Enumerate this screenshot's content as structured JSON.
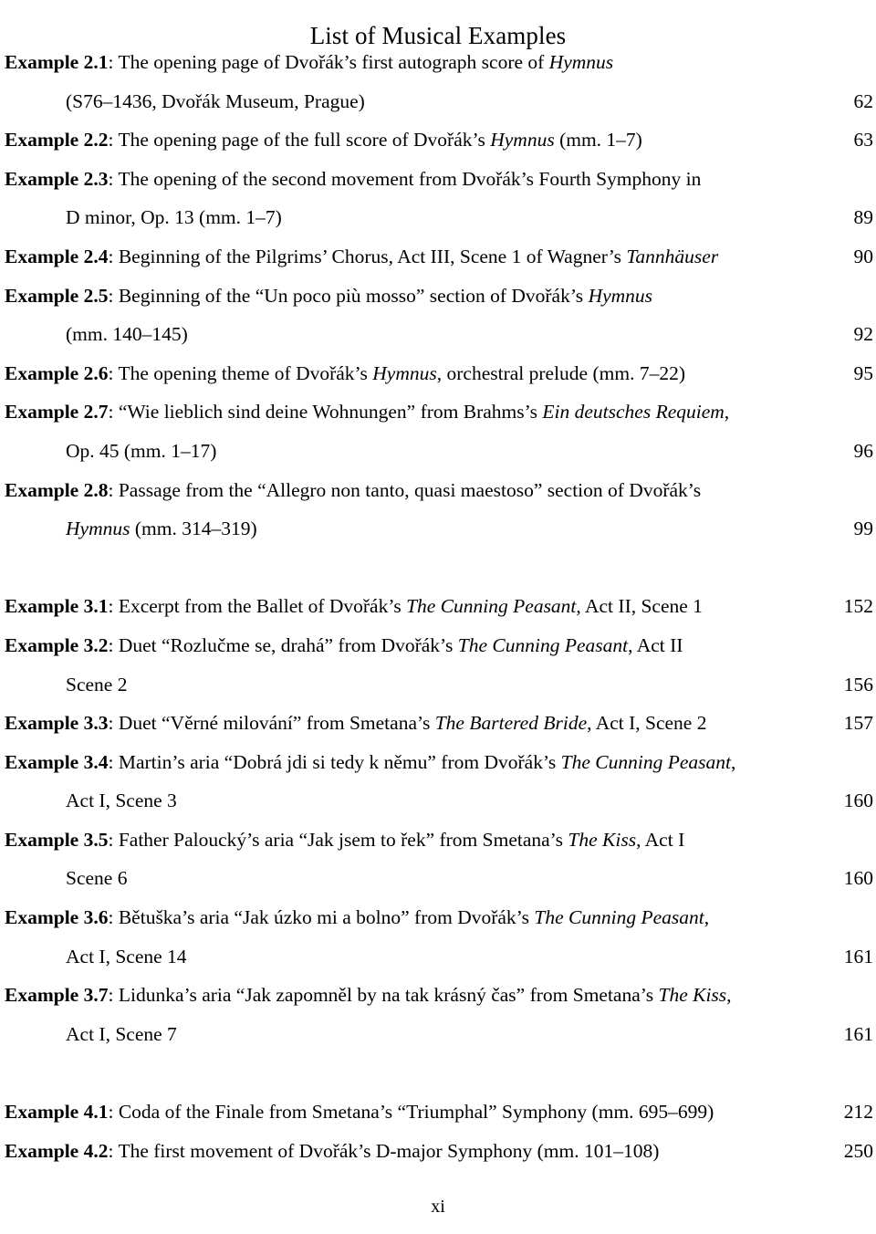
{
  "document": {
    "title": "List of Musical Examples",
    "folio": "xi"
  },
  "entries": [
    {
      "id": "example-2-1",
      "label": "Example 2.1",
      "sep": ": ",
      "lines": [
        {
          "indent": false,
          "segments": [
            {
              "text": "Example 2.1",
              "style": "bold"
            },
            {
              "text": ": The opening page of Dvořák’s first autograph score of ",
              "style": "normal"
            },
            {
              "text": "Hymnus",
              "style": "italic"
            }
          ],
          "page": ""
        },
        {
          "indent": true,
          "segments": [
            {
              "text": "(S76–1436, Dvořák Museum, Prague)",
              "style": "normal"
            }
          ],
          "page": "62"
        }
      ]
    },
    {
      "id": "example-2-2",
      "label": "Example 2.2",
      "lines": [
        {
          "indent": false,
          "segments": [
            {
              "text": "Example 2.2",
              "style": "bold"
            },
            {
              "text": ": The opening page of the full score of Dvořák’s ",
              "style": "normal"
            },
            {
              "text": "Hymnus",
              "style": "italic"
            },
            {
              "text": " (mm. 1–7)",
              "style": "normal"
            }
          ],
          "page": "63"
        }
      ]
    },
    {
      "id": "example-2-3",
      "label": "Example 2.3",
      "lines": [
        {
          "indent": false,
          "segments": [
            {
              "text": "Example 2.3",
              "style": "bold"
            },
            {
              "text": ": The opening of the second movement from Dvořák’s Fourth Symphony in",
              "style": "normal"
            }
          ],
          "page": ""
        },
        {
          "indent": true,
          "segments": [
            {
              "text": "D minor, Op. 13 (mm. 1–7)",
              "style": "normal"
            }
          ],
          "page": "89"
        }
      ]
    },
    {
      "id": "example-2-4",
      "label": "Example 2.4",
      "lines": [
        {
          "indent": false,
          "segments": [
            {
              "text": "Example 2.4",
              "style": "bold"
            },
            {
              "text": ": Beginning of the Pilgrims’ Chorus, Act III, Scene 1 of Wagner’s ",
              "style": "normal"
            },
            {
              "text": "Tannhäuser",
              "style": "italic"
            }
          ],
          "page": "90"
        }
      ]
    },
    {
      "id": "example-2-5",
      "label": "Example 2.5",
      "lines": [
        {
          "indent": false,
          "segments": [
            {
              "text": "Example 2.5",
              "style": "bold"
            },
            {
              "text": ": Beginning of the “Un poco più mosso” section of Dvořák’s ",
              "style": "normal"
            },
            {
              "text": "Hymnus",
              "style": "italic"
            }
          ],
          "page": ""
        },
        {
          "indent": true,
          "segments": [
            {
              "text": "(mm. 140–145)",
              "style": "normal"
            }
          ],
          "page": "92"
        }
      ]
    },
    {
      "id": "example-2-6",
      "label": "Example 2.6",
      "lines": [
        {
          "indent": false,
          "segments": [
            {
              "text": "Example 2.6",
              "style": "bold"
            },
            {
              "text": ": The opening theme of Dvořák’s ",
              "style": "normal"
            },
            {
              "text": "Hymnus",
              "style": "italic"
            },
            {
              "text": ", orchestral prelude (mm. 7–22)",
              "style": "normal"
            }
          ],
          "page": "95"
        }
      ]
    },
    {
      "id": "example-2-7",
      "label": "Example 2.7",
      "lines": [
        {
          "indent": false,
          "segments": [
            {
              "text": "Example 2.7",
              "style": "bold"
            },
            {
              "text": ": “Wie lieblich sind deine Wohnungen” from Brahms’s ",
              "style": "normal"
            },
            {
              "text": "Ein deutsches Requiem",
              "style": "italic"
            },
            {
              "text": ",",
              "style": "normal"
            }
          ],
          "page": ""
        },
        {
          "indent": true,
          "segments": [
            {
              "text": "Op. 45 (mm. 1–17)",
              "style": "normal"
            }
          ],
          "page": "96"
        }
      ]
    },
    {
      "id": "example-2-8",
      "label": "Example 2.8",
      "lines": [
        {
          "indent": false,
          "segments": [
            {
              "text": "Example 2.8",
              "style": "bold"
            },
            {
              "text": ": Passage from the “Allegro non tanto, quasi maestoso” section of Dvořák’s",
              "style": "normal"
            }
          ],
          "page": ""
        },
        {
          "indent": true,
          "segments": [
            {
              "text": "Hymnus",
              "style": "italic"
            },
            {
              "text": " (mm. 314–319)",
              "style": "normal"
            }
          ],
          "page": "99"
        }
      ]
    },
    {
      "id": "spacer-1",
      "spacer": true,
      "lines": [
        {
          "indent": false,
          "segments": [],
          "page": ""
        }
      ]
    },
    {
      "id": "example-3-1",
      "label": "Example 3.1",
      "lines": [
        {
          "indent": false,
          "segments": [
            {
              "text": "Example 3.1",
              "style": "bold"
            },
            {
              "text": ": Excerpt from the Ballet of Dvořák’s ",
              "style": "normal"
            },
            {
              "text": "The Cunning Peasant",
              "style": "italic"
            },
            {
              "text": ", Act II, Scene 1",
              "style": "normal"
            }
          ],
          "page": "152"
        }
      ]
    },
    {
      "id": "example-3-2",
      "label": "Example 3.2",
      "lines": [
        {
          "indent": false,
          "segments": [
            {
              "text": "Example 3.2",
              "style": "bold"
            },
            {
              "text": ": Duet “Rozlučme se, drahá” from Dvořák’s ",
              "style": "normal"
            },
            {
              "text": "The Cunning Peasant",
              "style": "italic"
            },
            {
              "text": ", Act II",
              "style": "normal"
            }
          ],
          "page": ""
        },
        {
          "indent": true,
          "segments": [
            {
              "text": "Scene 2",
              "style": "normal"
            }
          ],
          "page": "156"
        }
      ]
    },
    {
      "id": "example-3-3",
      "label": "Example 3.3",
      "lines": [
        {
          "indent": false,
          "segments": [
            {
              "text": "Example 3.3",
              "style": "bold"
            },
            {
              "text": ": Duet “Věrné milování” from Smetana’s ",
              "style": "normal"
            },
            {
              "text": "The Bartered Bride",
              "style": "italic"
            },
            {
              "text": ", Act I, Scene 2",
              "style": "normal"
            }
          ],
          "page": "157"
        }
      ]
    },
    {
      "id": "example-3-4",
      "label": "Example 3.4",
      "lines": [
        {
          "indent": false,
          "segments": [
            {
              "text": "Example 3.4",
              "style": "bold"
            },
            {
              "text": ": Martin’s aria “Dobrá jdi si tedy k němu” from Dvořák’s ",
              "style": "normal"
            },
            {
              "text": "The Cunning Peasant",
              "style": "italic"
            },
            {
              "text": ",",
              "style": "normal"
            }
          ],
          "page": ""
        },
        {
          "indent": true,
          "segments": [
            {
              "text": "Act I, Scene 3",
              "style": "normal"
            }
          ],
          "page": "160"
        }
      ]
    },
    {
      "id": "example-3-5",
      "label": "Example 3.5",
      "lines": [
        {
          "indent": false,
          "segments": [
            {
              "text": "Example 3.5",
              "style": "bold"
            },
            {
              "text": ": Father Paloucký’s aria “Jak jsem to řek” from Smetana’s ",
              "style": "normal"
            },
            {
              "text": "The Kiss",
              "style": "italic"
            },
            {
              "text": ", Act I",
              "style": "normal"
            }
          ],
          "page": ""
        },
        {
          "indent": true,
          "segments": [
            {
              "text": "Scene 6",
              "style": "normal"
            }
          ],
          "page": "160"
        }
      ]
    },
    {
      "id": "example-3-6",
      "label": "Example 3.6",
      "lines": [
        {
          "indent": false,
          "segments": [
            {
              "text": "Example 3.6",
              "style": "bold"
            },
            {
              "text": ": Bětuška’s aria “Jak úzko mi a bolno” from Dvořák’s ",
              "style": "normal"
            },
            {
              "text": "The Cunning Peasant",
              "style": "italic"
            },
            {
              "text": ",",
              "style": "normal"
            }
          ],
          "page": ""
        },
        {
          "indent": true,
          "segments": [
            {
              "text": "Act I, Scene 14",
              "style": "normal"
            }
          ],
          "page": "161"
        }
      ]
    },
    {
      "id": "example-3-7",
      "label": "Example 3.7",
      "lines": [
        {
          "indent": false,
          "segments": [
            {
              "text": "Example 3.7",
              "style": "bold"
            },
            {
              "text": ": Lidunka’s aria “Jak zapomněl by na tak krásný čas” from Smetana’s ",
              "style": "normal"
            },
            {
              "text": "The Kiss",
              "style": "italic"
            },
            {
              "text": ",",
              "style": "normal"
            }
          ],
          "page": ""
        },
        {
          "indent": true,
          "segments": [
            {
              "text": "Act I, Scene 7",
              "style": "normal"
            }
          ],
          "page": "161"
        }
      ]
    },
    {
      "id": "spacer-2",
      "spacer": true,
      "lines": [
        {
          "indent": false,
          "segments": [],
          "page": ""
        }
      ]
    },
    {
      "id": "example-4-1",
      "label": "Example 4.1",
      "lines": [
        {
          "indent": false,
          "segments": [
            {
              "text": "Example 4.1",
              "style": "bold"
            },
            {
              "text": ": Coda of the Finale from Smetana’s “Triumphal” Symphony (mm. 695–699)",
              "style": "normal"
            }
          ],
          "page": "212"
        }
      ]
    },
    {
      "id": "example-4-2",
      "label": "Example 4.2",
      "lines": [
        {
          "indent": false,
          "segments": [
            {
              "text": "Example 4.2",
              "style": "bold"
            },
            {
              "text": ": The first movement of Dvořák’s D-major Symphony (mm. 101–108)",
              "style": "normal"
            }
          ],
          "page": "250"
        }
      ]
    }
  ]
}
